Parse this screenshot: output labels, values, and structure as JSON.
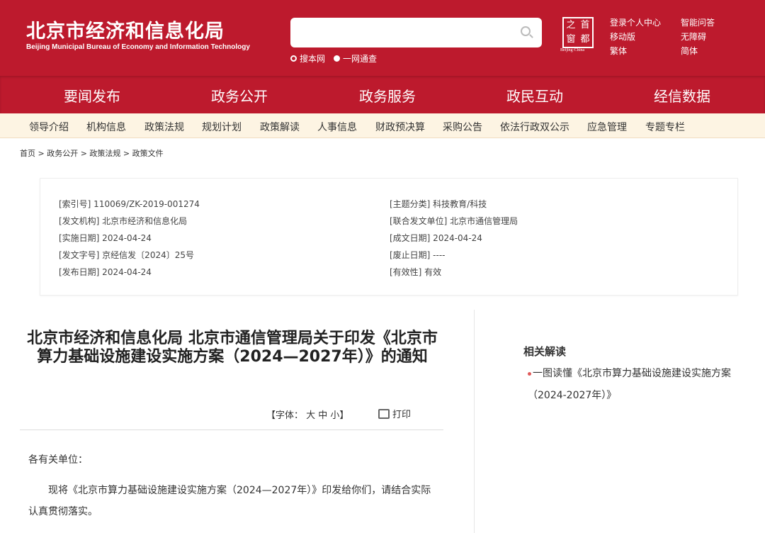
{
  "header": {
    "title_cn": "北京市经济和信息化局",
    "title_en": "Beijing Municipal Bureau of Economy and Information Technology",
    "search_placeholder": "",
    "search_options": [
      "搜本网",
      "一网通查"
    ],
    "seal_chars": [
      "之",
      "首",
      "窗",
      "都"
    ],
    "seal_en": "Beijing·China",
    "links": [
      "登录个人中心",
      "智能问答",
      "移动版",
      "无障碍",
      "繁体",
      "简体"
    ]
  },
  "nav": [
    "要闻发布",
    "政务公开",
    "政务服务",
    "政民互动",
    "经信数据"
  ],
  "subnav": [
    "领导介绍",
    "机构信息",
    "政策法规",
    "规划计划",
    "政策解读",
    "人事信息",
    "财政预决算",
    "采购公告",
    "依法行政双公示",
    "应急管理",
    "专题专栏"
  ],
  "breadcrumb": "首页 > 政务公开 > 政策法规 > 政策文件",
  "meta": {
    "left": [
      "[索引号] 110069/ZK-2019-001274",
      "[发文机构] 北京市经济和信息化局",
      "[实施日期] 2024-04-24",
      "[发文字号] 京经信发〔2024〕25号",
      "[发布日期] 2024-04-24"
    ],
    "right": [
      "[主题分类] 科技教育/科技",
      "[联合发文单位] 北京市通信管理局",
      "[成文日期] 2024-04-24",
      "[废止日期] ----",
      "[有效性] 有效"
    ]
  },
  "article": {
    "title": "北京市经济和信息化局 北京市通信管理局关于印发《北京市算力基础设施建设实施方案（2024—2027年）》的通知",
    "font_label": "【字体： 大 中 小】",
    "print_label": "打印",
    "salutation": "各有关单位：",
    "paragraph": "现将《北京市算力基础设施建设实施方案（2024—2027年）》印发给你们，请结合实际认真贯彻落实。"
  },
  "related": {
    "heading": "相关解读",
    "items": [
      "一图读懂《北京市算力基础设施建设实施方案（2024-2027年）》"
    ]
  }
}
